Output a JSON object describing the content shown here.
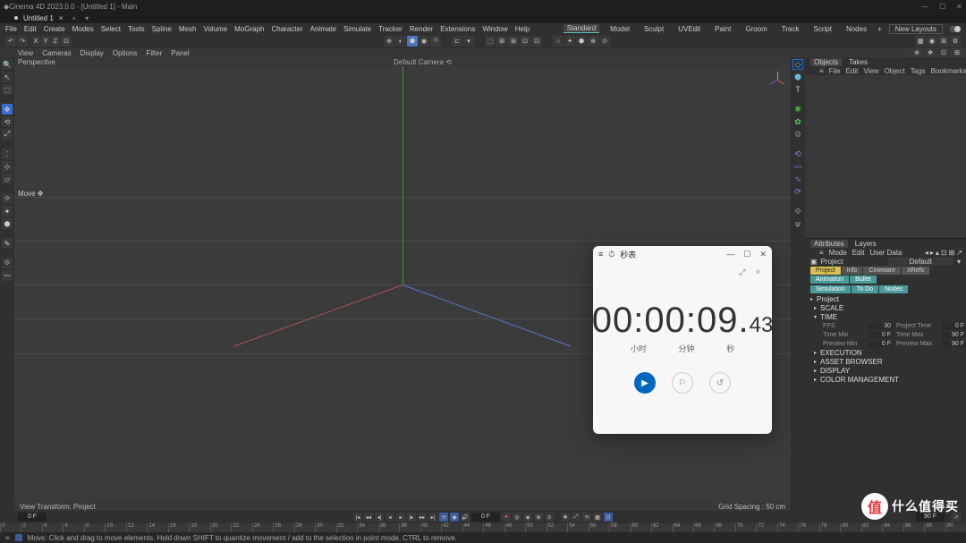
{
  "title": "Cinema 4D 2023.0.0 - [Untitled 1] - Main",
  "tab": {
    "name": "Untitled 1"
  },
  "menus": [
    "File",
    "Edit",
    "Create",
    "Modes",
    "Select",
    "Tools",
    "Spline",
    "Mesh",
    "Volume",
    "MoGraph",
    "Character",
    "Animate",
    "Simulate",
    "Tracker",
    "Render",
    "Extensions",
    "Window",
    "Help"
  ],
  "layouts": {
    "items": [
      "Standard",
      "Model",
      "Sculpt",
      "UVEdit",
      "Paint",
      "Groom",
      "Track",
      "Script",
      "Nodes"
    ],
    "active": 0,
    "new_btn": "New Layouts"
  },
  "axis_btns": [
    "X",
    "Y",
    "Z"
  ],
  "sub_menus": [
    "View",
    "Cameras",
    "Display",
    "Options",
    "Filter",
    "Panel"
  ],
  "viewport": {
    "label": "Perspective",
    "camera": "Default Camera ⟲",
    "footer_left": "View Transform: Project",
    "footer_right": "Grid Spacing : 50 cm"
  },
  "move_tooltip": "Move ✥",
  "object_panel": {
    "tabs": [
      "Objects",
      "Takes"
    ],
    "menus": [
      "File",
      "Edit",
      "View",
      "Object",
      "Tags",
      "Bookmarks"
    ]
  },
  "attr_panel": {
    "tabs": [
      "Attributes",
      "Layers"
    ],
    "menus": [
      "Mode",
      "Edit",
      "User Data"
    ],
    "title": "Project",
    "default": "Default",
    "pills_row1": [
      "Project",
      "Info",
      "Cineware",
      "XRefs",
      "Animation",
      "Bullet"
    ],
    "pills_row2": [
      "Simulation",
      "To Do",
      "Nodes"
    ],
    "section_project": "Project",
    "sections": {
      "scale": "SCALE",
      "time": "TIME",
      "execution": "EXECUTION",
      "asset": "ASSET BROWSER",
      "display": "DISPLAY",
      "color": "COLOR MANAGEMENT"
    },
    "time_fields": [
      {
        "label": "FPS",
        "value": "30",
        "label2": "Project Time",
        "value2": "0 F"
      },
      {
        "label": "Time Min",
        "value": "0 F",
        "label2": "Time Max",
        "value2": "90 F"
      },
      {
        "label": "Preview Min",
        "value": "0 F",
        "label2": "Preview Max",
        "value2": "90 F"
      }
    ]
  },
  "timeline": {
    "frame_left": "0 F",
    "frame_right": "0 F",
    "ticks": [
      "0",
      "2",
      "4",
      "6",
      "8",
      "10",
      "12",
      "14",
      "16",
      "18",
      "20",
      "22",
      "24",
      "26",
      "28",
      "30",
      "32",
      "34",
      "36",
      "38",
      "40",
      "42",
      "44",
      "46",
      "48",
      "50",
      "52",
      "54",
      "56",
      "58",
      "60",
      "62",
      "64",
      "66",
      "68",
      "70",
      "72",
      "74",
      "76",
      "78",
      "80",
      "82",
      "84",
      "86",
      "88",
      "90"
    ],
    "range": {
      "start": "0 F",
      "end": "90 F"
    }
  },
  "status": "Move: Click and drag to move elements. Hold down SHIFT to quantize movement / add to the selection in point mode, CTRL to remove.",
  "stopwatch": {
    "title": "秒表",
    "hours": "00",
    "minutes": "00",
    "seconds": "09",
    "frac": "43",
    "label_h": "小时",
    "label_m": "分钟",
    "label_s": "秒",
    "minimize": "—",
    "maximize": "☐",
    "close": "✕",
    "expand": "⤢",
    "pin": "✧"
  },
  "watermark": {
    "char": "值",
    "text": "什么值得买"
  },
  "right_icons": [
    "◇",
    "⬢",
    "T",
    "❋",
    "✿",
    "⚙",
    "⟲",
    "〰",
    "∿",
    "⟳",
    "⟐",
    "⍦"
  ]
}
